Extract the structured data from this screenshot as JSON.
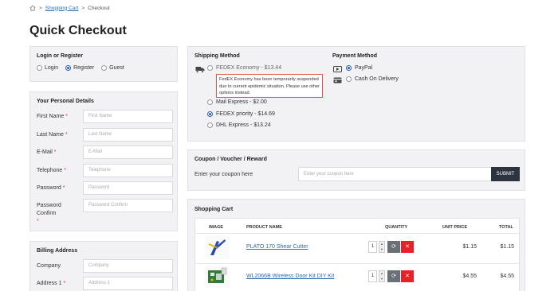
{
  "breadcrumb": {
    "link": "Shopping Cart",
    "sep1": ">",
    "sep2": ">",
    "current": "Checkout"
  },
  "page_title": "Quick Checkout",
  "login": {
    "title": "Login or Register",
    "options": [
      {
        "label": "Login",
        "selected": false
      },
      {
        "label": "Register",
        "selected": true
      },
      {
        "label": "Guest",
        "selected": false
      }
    ]
  },
  "personal": {
    "title": "Your Personal Details",
    "fields": [
      {
        "label": "First Name",
        "required": "*",
        "placeholder": "First Name"
      },
      {
        "label": "Last Name",
        "required": "*",
        "placeholder": "Last Name"
      },
      {
        "label": "E-Mail",
        "required": "*",
        "placeholder": "E-Mail"
      },
      {
        "label": "Telephone",
        "required": "*",
        "placeholder": "Telephone"
      },
      {
        "label": "Password",
        "required": "*",
        "placeholder": "Password"
      },
      {
        "label": "Password Confirm",
        "required": "*",
        "placeholder": "Password Confirm"
      }
    ]
  },
  "billing": {
    "title": "Billing Address",
    "fields": [
      {
        "label": "Company",
        "required": "",
        "placeholder": "Company"
      },
      {
        "label": "Address 1",
        "required": "*",
        "placeholder": "Address 1"
      }
    ]
  },
  "shipping": {
    "title": "Shipping Method",
    "warning": "FedEX Economy has been temporarily suspended due to current epidemic situation. Please use other options instead.",
    "options": [
      {
        "label": "FEDEX Economy - $13.44",
        "selected": false
      },
      {
        "label": "Mail Express - $2.00",
        "selected": false
      },
      {
        "label": "FEDEX priority - $14.69",
        "selected": true
      },
      {
        "label": "DHL Express - $13.24",
        "selected": false
      }
    ]
  },
  "payment": {
    "title": "Payment Method",
    "options": [
      {
        "label": "PayPal",
        "selected": true
      },
      {
        "label": "Cash On Delivery",
        "selected": false
      }
    ]
  },
  "coupon": {
    "title": "Coupon / Voucher / Reward",
    "label": "Enter your coupon here",
    "placeholder": "Enter your coupon here",
    "button": "SUBMIT"
  },
  "cart": {
    "title": "Shopping Cart",
    "headers": {
      "image": "IMAGE",
      "product": "PRODUCT NAME",
      "quantity": "QUANTITY",
      "unit_price": "UNIT PRICE",
      "total": "TOTAL"
    },
    "rows": [
      {
        "name": "PLATO 170 Shear Cutter",
        "qty": "1",
        "unit_price": "$1.15",
        "total": "$1.15"
      },
      {
        "name": "WL2066B Wireless Door Kit DIY Kit",
        "qty": "1",
        "unit_price": "$4.55",
        "total": "$4.55"
      }
    ]
  },
  "colors": {
    "accent": "#2a5db0",
    "panel_bg": "#f2f2f5",
    "remove": "#e8202a",
    "submit": "#2d3440"
  }
}
